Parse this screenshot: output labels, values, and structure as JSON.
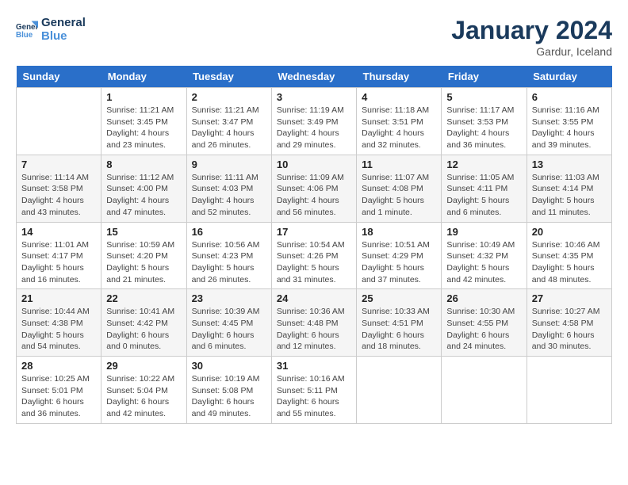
{
  "header": {
    "logo_line1": "General",
    "logo_line2": "Blue",
    "month": "January 2024",
    "location": "Gardur, Iceland"
  },
  "weekdays": [
    "Sunday",
    "Monday",
    "Tuesday",
    "Wednesday",
    "Thursday",
    "Friday",
    "Saturday"
  ],
  "weeks": [
    [
      null,
      {
        "day": "1",
        "sunrise": "Sunrise: 11:21 AM",
        "sunset": "Sunset: 3:45 PM",
        "daylight": "Daylight: 4 hours and 23 minutes."
      },
      {
        "day": "2",
        "sunrise": "Sunrise: 11:21 AM",
        "sunset": "Sunset: 3:47 PM",
        "daylight": "Daylight: 4 hours and 26 minutes."
      },
      {
        "day": "3",
        "sunrise": "Sunrise: 11:19 AM",
        "sunset": "Sunset: 3:49 PM",
        "daylight": "Daylight: 4 hours and 29 minutes."
      },
      {
        "day": "4",
        "sunrise": "Sunrise: 11:18 AM",
        "sunset": "Sunset: 3:51 PM",
        "daylight": "Daylight: 4 hours and 32 minutes."
      },
      {
        "day": "5",
        "sunrise": "Sunrise: 11:17 AM",
        "sunset": "Sunset: 3:53 PM",
        "daylight": "Daylight: 4 hours and 36 minutes."
      },
      {
        "day": "6",
        "sunrise": "Sunrise: 11:16 AM",
        "sunset": "Sunset: 3:55 PM",
        "daylight": "Daylight: 4 hours and 39 minutes."
      }
    ],
    [
      {
        "day": "7",
        "sunrise": "Sunrise: 11:14 AM",
        "sunset": "Sunset: 3:58 PM",
        "daylight": "Daylight: 4 hours and 43 minutes."
      },
      {
        "day": "8",
        "sunrise": "Sunrise: 11:12 AM",
        "sunset": "Sunset: 4:00 PM",
        "daylight": "Daylight: 4 hours and 47 minutes."
      },
      {
        "day": "9",
        "sunrise": "Sunrise: 11:11 AM",
        "sunset": "Sunset: 4:03 PM",
        "daylight": "Daylight: 4 hours and 52 minutes."
      },
      {
        "day": "10",
        "sunrise": "Sunrise: 11:09 AM",
        "sunset": "Sunset: 4:06 PM",
        "daylight": "Daylight: 4 hours and 56 minutes."
      },
      {
        "day": "11",
        "sunrise": "Sunrise: 11:07 AM",
        "sunset": "Sunset: 4:08 PM",
        "daylight": "Daylight: 5 hours and 1 minute."
      },
      {
        "day": "12",
        "sunrise": "Sunrise: 11:05 AM",
        "sunset": "Sunset: 4:11 PM",
        "daylight": "Daylight: 5 hours and 6 minutes."
      },
      {
        "day": "13",
        "sunrise": "Sunrise: 11:03 AM",
        "sunset": "Sunset: 4:14 PM",
        "daylight": "Daylight: 5 hours and 11 minutes."
      }
    ],
    [
      {
        "day": "14",
        "sunrise": "Sunrise: 11:01 AM",
        "sunset": "Sunset: 4:17 PM",
        "daylight": "Daylight: 5 hours and 16 minutes."
      },
      {
        "day": "15",
        "sunrise": "Sunrise: 10:59 AM",
        "sunset": "Sunset: 4:20 PM",
        "daylight": "Daylight: 5 hours and 21 minutes."
      },
      {
        "day": "16",
        "sunrise": "Sunrise: 10:56 AM",
        "sunset": "Sunset: 4:23 PM",
        "daylight": "Daylight: 5 hours and 26 minutes."
      },
      {
        "day": "17",
        "sunrise": "Sunrise: 10:54 AM",
        "sunset": "Sunset: 4:26 PM",
        "daylight": "Daylight: 5 hours and 31 minutes."
      },
      {
        "day": "18",
        "sunrise": "Sunrise: 10:51 AM",
        "sunset": "Sunset: 4:29 PM",
        "daylight": "Daylight: 5 hours and 37 minutes."
      },
      {
        "day": "19",
        "sunrise": "Sunrise: 10:49 AM",
        "sunset": "Sunset: 4:32 PM",
        "daylight": "Daylight: 5 hours and 42 minutes."
      },
      {
        "day": "20",
        "sunrise": "Sunrise: 10:46 AM",
        "sunset": "Sunset: 4:35 PM",
        "daylight": "Daylight: 5 hours and 48 minutes."
      }
    ],
    [
      {
        "day": "21",
        "sunrise": "Sunrise: 10:44 AM",
        "sunset": "Sunset: 4:38 PM",
        "daylight": "Daylight: 5 hours and 54 minutes."
      },
      {
        "day": "22",
        "sunrise": "Sunrise: 10:41 AM",
        "sunset": "Sunset: 4:42 PM",
        "daylight": "Daylight: 6 hours and 0 minutes."
      },
      {
        "day": "23",
        "sunrise": "Sunrise: 10:39 AM",
        "sunset": "Sunset: 4:45 PM",
        "daylight": "Daylight: 6 hours and 6 minutes."
      },
      {
        "day": "24",
        "sunrise": "Sunrise: 10:36 AM",
        "sunset": "Sunset: 4:48 PM",
        "daylight": "Daylight: 6 hours and 12 minutes."
      },
      {
        "day": "25",
        "sunrise": "Sunrise: 10:33 AM",
        "sunset": "Sunset: 4:51 PM",
        "daylight": "Daylight: 6 hours and 18 minutes."
      },
      {
        "day": "26",
        "sunrise": "Sunrise: 10:30 AM",
        "sunset": "Sunset: 4:55 PM",
        "daylight": "Daylight: 6 hours and 24 minutes."
      },
      {
        "day": "27",
        "sunrise": "Sunrise: 10:27 AM",
        "sunset": "Sunset: 4:58 PM",
        "daylight": "Daylight: 6 hours and 30 minutes."
      }
    ],
    [
      {
        "day": "28",
        "sunrise": "Sunrise: 10:25 AM",
        "sunset": "Sunset: 5:01 PM",
        "daylight": "Daylight: 6 hours and 36 minutes."
      },
      {
        "day": "29",
        "sunrise": "Sunrise: 10:22 AM",
        "sunset": "Sunset: 5:04 PM",
        "daylight": "Daylight: 6 hours and 42 minutes."
      },
      {
        "day": "30",
        "sunrise": "Sunrise: 10:19 AM",
        "sunset": "Sunset: 5:08 PM",
        "daylight": "Daylight: 6 hours and 49 minutes."
      },
      {
        "day": "31",
        "sunrise": "Sunrise: 10:16 AM",
        "sunset": "Sunset: 5:11 PM",
        "daylight": "Daylight: 6 hours and 55 minutes."
      },
      null,
      null,
      null
    ]
  ]
}
